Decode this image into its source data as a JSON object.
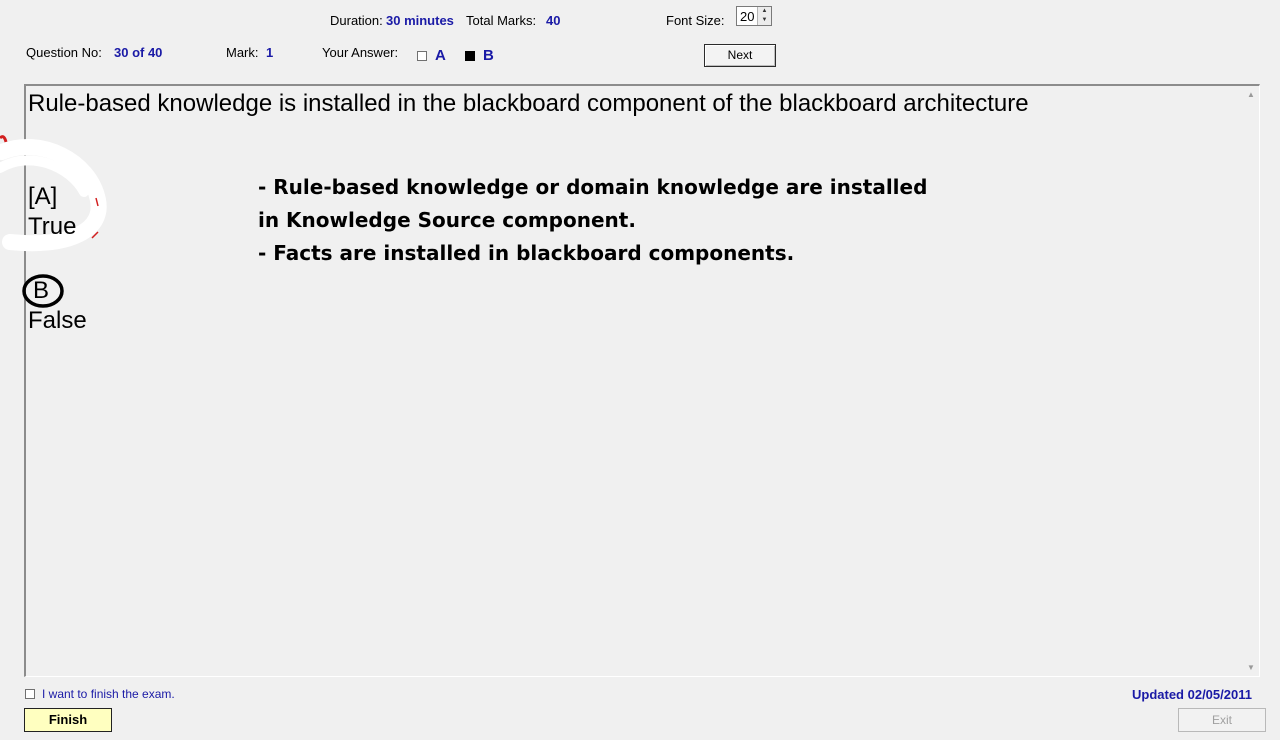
{
  "header": {
    "duration_label": "Duration:",
    "duration_value": "30 minutes",
    "total_marks_label": "Total Marks:",
    "total_marks_value": "40",
    "font_size_label": "Font Size:",
    "font_size_value": "20",
    "question_no_label": "Question No:",
    "question_no_value": "30 of 40",
    "mark_label": "Mark:",
    "mark_value": "1",
    "your_answer_label": "Your Answer:",
    "answer_a_label": "A",
    "answer_a_checked": false,
    "answer_b_label": "B",
    "answer_b_checked": true,
    "next_button": "Next"
  },
  "question": {
    "text": "Rule-based knowledge is installed in the blackboard component of the blackboard architecture",
    "options": [
      {
        "key": "[A]",
        "text": "True"
      },
      {
        "key": "B",
        "text": "False"
      }
    ]
  },
  "annotation": {
    "lines": [
      "- Rule-based knowledge or domain knowledge are installed",
      "in Knowledge Source component.",
      "- Facts are installed in blackboard components."
    ]
  },
  "footer": {
    "finish_checkbox_label": "I want to finish the exam.",
    "finish_button": "Finish",
    "updated": "Updated 02/05/2011",
    "exit_button": "Exit"
  },
  "colors": {
    "background": "#f0f0f0",
    "accent_blue": "#1a1aa6",
    "finish_button_bg": "#ffffc0"
  }
}
